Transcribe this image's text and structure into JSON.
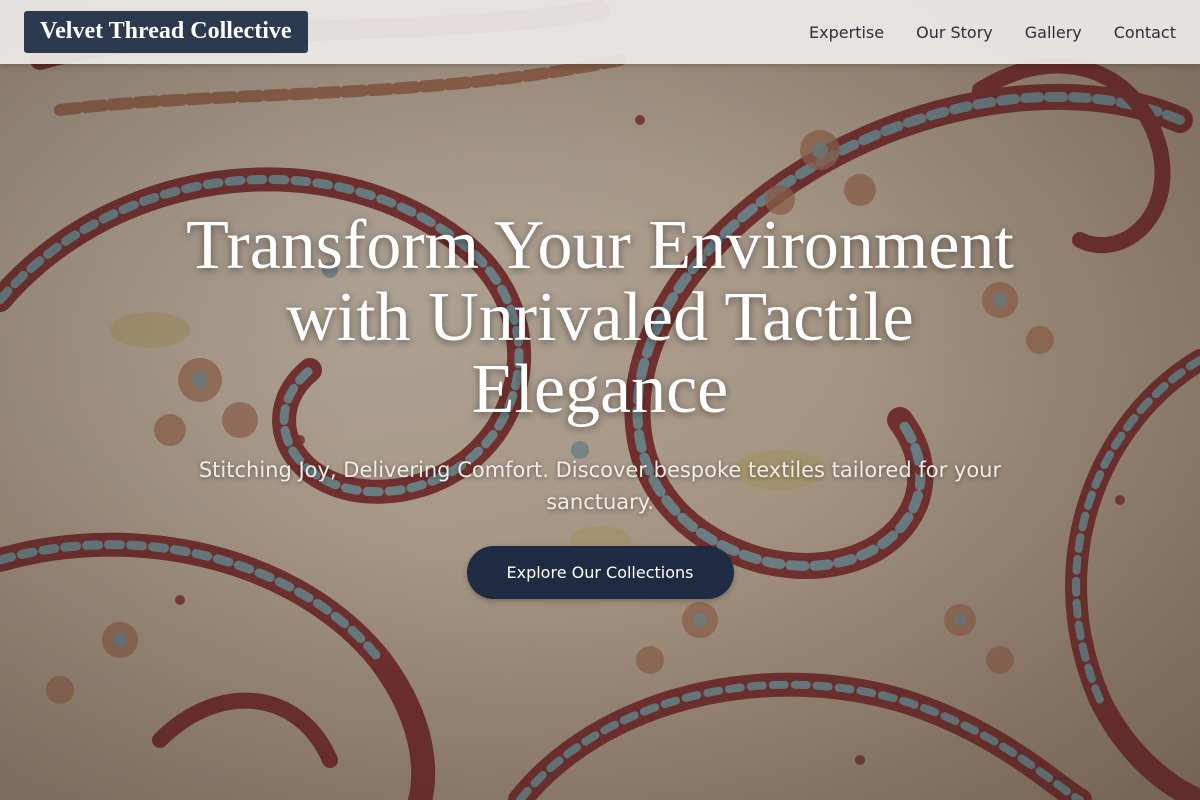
{
  "header": {
    "brand": "Velvet Thread Collective",
    "nav": [
      {
        "label": "Expertise"
      },
      {
        "label": "Our Story"
      },
      {
        "label": "Gallery"
      },
      {
        "label": "Contact"
      }
    ]
  },
  "hero": {
    "headline": "Transform Your Environment with Unrivaled Tactile Elegance",
    "subtitle": "Stitching Joy, Delivering Comfort. Discover bespoke textiles tailored for your sanctuary.",
    "cta_label": "Explore Our Collections",
    "background_image": "paisley-textile-pattern"
  },
  "colors": {
    "brand_bg": "#2c3a50",
    "cta_bg": "#1f2b42",
    "header_bg": "#eceae8",
    "paisley_red": "#8b2a2a",
    "paisley_blue": "#7fa9b4",
    "paisley_cream": "#e9dcc6"
  }
}
